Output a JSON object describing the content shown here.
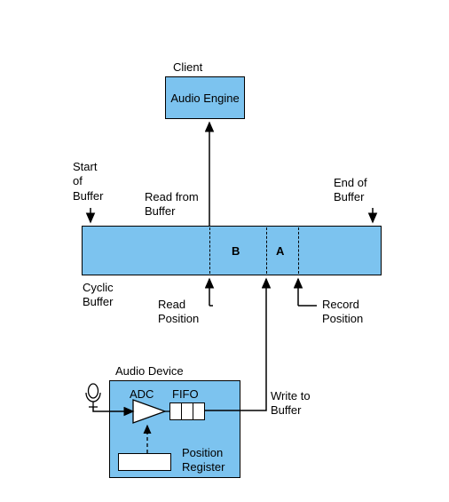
{
  "client_label": "Client",
  "engine_label": "Audio\nEngine",
  "start_of_buffer": "Start\nof\nBuffer",
  "end_of_buffer": "End of\nBuffer",
  "read_from_buffer": "Read from\nBuffer",
  "cyclic_buffer": "Cyclic\nBuffer",
  "read_position": "Read\nPosition",
  "record_position": "Record\nPosition",
  "region_b": "B",
  "region_a": "A",
  "audio_device": "Audio Device",
  "adc_label": "ADC",
  "fifo_label": "FIFO",
  "write_to_buffer": "Write to\nBuffer",
  "position_register": "Position\nRegister",
  "colors": {
    "fill": "#7cc3ef",
    "line": "#000000"
  }
}
